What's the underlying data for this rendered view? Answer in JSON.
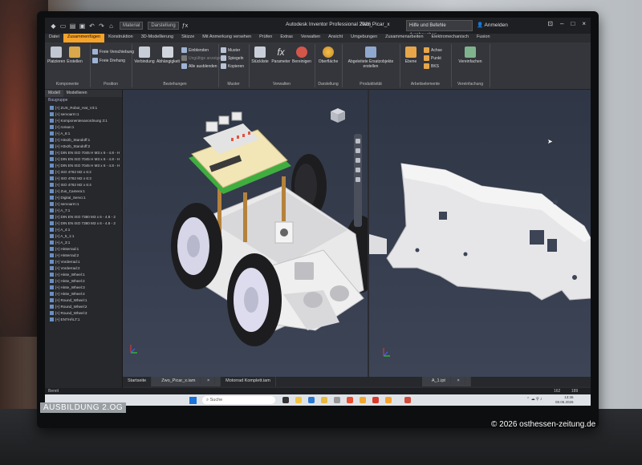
{
  "window": {
    "app_title": "Autodesk Inventor Professional 2026",
    "file_title": "Zwo_Picar_x",
    "help_search_placeholder": "Hilfe und Befehle durchsuchen...",
    "sign_in": "Anmelden",
    "material_box": "Material",
    "appearance_box": "Darstellung"
  },
  "menu_tabs": [
    "Datei",
    "Zusammenfügen",
    "Konstruktion",
    "3D-Modellierung",
    "Skizze",
    "Mit Anmerkung versehen",
    "Prüfen",
    "Extras",
    "Verwalten",
    "Ansicht",
    "Umgebungen",
    "Zusammenarbeiten",
    "Elektromechanisch",
    "Fusion"
  ],
  "ribbon": {
    "groups": [
      {
        "label": "Komponente",
        "buttons": [
          "Platzieren",
          "Erstellen"
        ],
        "small": [
          "Freie Verschiebung",
          "Freie Drehung"
        ]
      },
      {
        "label": "Position",
        "buttons": [],
        "small": []
      },
      {
        "label": "Beziehungen",
        "buttons": [
          "Verbindung",
          "Abhängigkeit"
        ],
        "small": [
          "Einblenden",
          "Ungültige anzeigen",
          "Alle ausblenden"
        ]
      },
      {
        "label": "Muster",
        "buttons": [],
        "small": [
          "Muster",
          "Spiegeln",
          "Kopieren"
        ]
      },
      {
        "label": "Verwalten",
        "buttons": [
          "Stückliste",
          "Parameter",
          "Bereinigen"
        ],
        "small": []
      },
      {
        "label": "Darstellung",
        "buttons": [
          "Oberfläche"
        ],
        "small": []
      },
      {
        "label": "Produktivität",
        "buttons": [
          "Abgeleitete Ersatzobjekte erstellen"
        ],
        "small": []
      },
      {
        "label": "Arbeitselemente",
        "buttons": [
          "Ebene"
        ],
        "small": [
          "Achse",
          "Punkt",
          "BKS"
        ]
      },
      {
        "label": "Vereinfachung",
        "buttons": [
          "Vereinfachen"
        ],
        "small": []
      }
    ]
  },
  "browser": {
    "tabs": [
      "Modell",
      "Modellieren"
    ],
    "subheader": "Baugruppe",
    "items": [
      "[+] ZUS_Robot_Hat_V3:1",
      "[+] servoarm:1",
      "[+] Komponentenanordnung 3:1",
      "[+] roman:1",
      "[+] A_6:1",
      "[+] H3x2b_Standoff:1",
      "[+] H3x2b_Standoff:2",
      "[+] DIN EN ISO 7045 H M3 x 6 - 4.8 - H",
      "[+] DIN EN ISO 7045 H M3 x 6 - 4.8 - H",
      "[+] DIN EN ISO 7045 H M3 x 6 - 4.8 - H",
      "[+] ISO 4762 M2 x 6:2",
      "[+] ISO 4762 M2 x 6:3",
      "[+] ISO 4762 M2 x 6:4",
      "[+] Zus_Camera:1",
      "[+] Digital_Servo:1",
      "[+] servoarm:1",
      "[+] A_7:1",
      "[+] DIN EN ISO 7380 M3 x 6 - 4.8 - 2",
      "[+] DIN EN ISO 7380 M3 x 6 - 4.8 - 2",
      "[+] A_4:1",
      "[+] A_5_1:1",
      "[+] A_3:1",
      "[+] Hinterrad:1",
      "[+] Hinterrad:2",
      "[+] Vorderrad:1",
      "[+] Vorderrad:2",
      "[+] Hinte_Wheel:1",
      "[+] Hinte_Wheel:2",
      "[+] Hinte_Wheel:3",
      "[+] Hinte_Wheel:4",
      "[+] Round_Wheel:1",
      "[+] Round_Wheel:2",
      "[+] Round_Wheel:3",
      "[+] ENTHÄLT:1"
    ]
  },
  "document_tabs": [
    "Startseite",
    "Zwo_Picar_x.iam",
    "Motorrad Komplett.iam"
  ],
  "document_tab_right": "A_1.ipt",
  "status_text": "Bereit",
  "status_numbers": [
    "162",
    "189"
  ],
  "taskbar": {
    "search_placeholder": "Suche",
    "time": "13:36",
    "date": "08.05.2026"
  },
  "overlay": {
    "left_watermark": "AUSBILDUNG 2.OG",
    "copyright": "© 2026 osthessen-zeitung.de"
  },
  "colors": {
    "active_tab": "#f6a32b",
    "viewport_top": "#2f3645",
    "viewport_bottom": "#3c4456",
    "pcb_green": "#3fae3f",
    "part_white": "#e9e9ea",
    "tyre_black": "#1d1d1f"
  }
}
